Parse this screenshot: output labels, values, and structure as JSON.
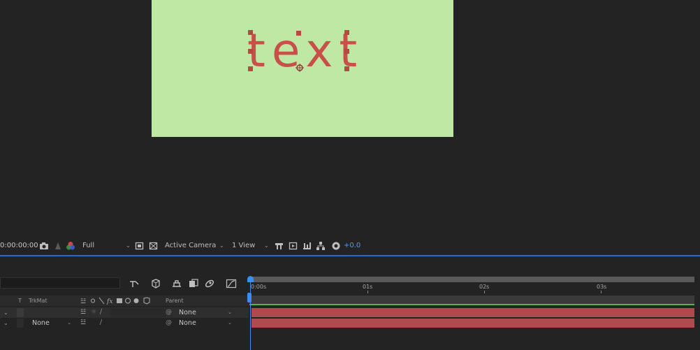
{
  "composition": {
    "text": "text",
    "background_color": "#bfe8a5",
    "text_color": "#c95048"
  },
  "viewer_toolbar": {
    "timecode": "0:00:00:00",
    "resolution": "Full",
    "camera": "Active Camera",
    "views": "1 View",
    "exposure": "+0.0",
    "icons": [
      "camera-icon",
      "color-wheel-icon",
      "region-icon",
      "transparency-grid-icon",
      "layout-icon",
      "reset-exposure-icon"
    ]
  },
  "timeline": {
    "columns": {
      "type": "T",
      "trkmat": "TrkMat",
      "parent": "Parent"
    },
    "ruler": {
      "labels": [
        "0:00s",
        "01s",
        "02s",
        "03s"
      ]
    },
    "rows": [
      {
        "trkmat": "",
        "parent": "None"
      },
      {
        "trkmat": "None",
        "parent": "None"
      }
    ],
    "accent_color": "#3d8cf0",
    "layer_bar_color": "#b04a4f"
  }
}
